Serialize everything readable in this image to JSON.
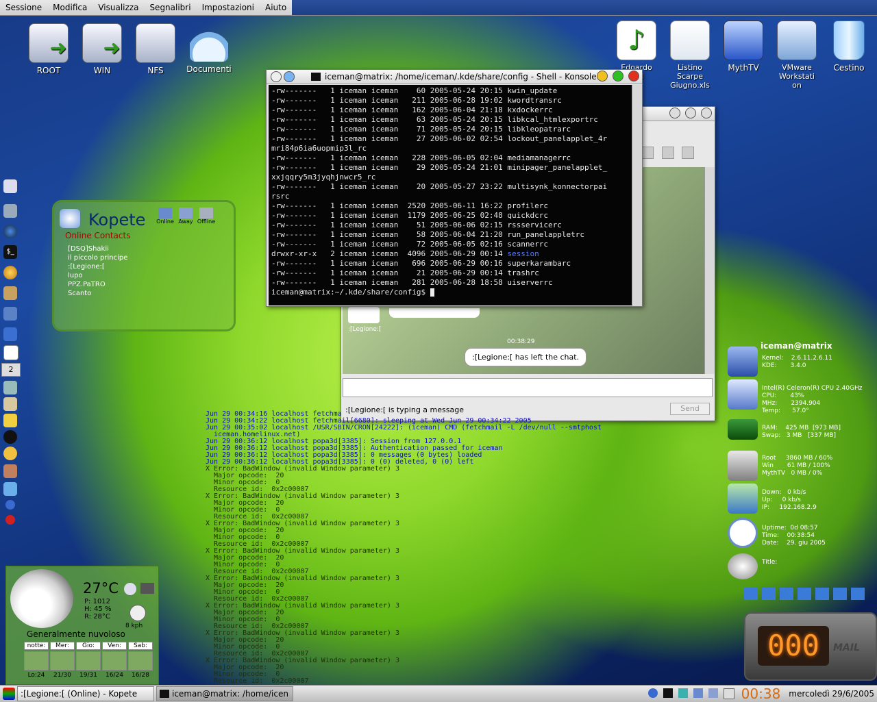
{
  "menubar": {
    "items": [
      "Sessione",
      "Modifica",
      "Visualizza",
      "Segnalibri",
      "Impostazioni",
      "Aiuto"
    ]
  },
  "desktop_icons_left": [
    "ROOT",
    "WIN",
    "NFS",
    "Documenti"
  ],
  "desktop_icons_right": [
    {
      "label": "Edoardo\n...-Il\nn...",
      "icon": "music-note-icon"
    },
    {
      "label": "Listino\nScarpe\nGiugno.xls",
      "icon": "spreadsheet-icon"
    },
    {
      "label": "MythTV",
      "icon": "monitor-icon"
    },
    {
      "label": "VMware\nWorkstati\non",
      "icon": "vmware-icon"
    },
    {
      "label": "Cestino",
      "icon": "trash-icon"
    }
  ],
  "konsole": {
    "title": "iceman@matrix: /home/iceman/.kde/share/config - Shell - Konsole",
    "lines": [
      "-rw-------   1 iceman iceman    60 2005-05-24 20:15 kwin_update",
      "-rw-------   1 iceman iceman   211 2005-06-28 19:02 kwordtransrc",
      "-rw-------   1 iceman iceman   162 2005-06-04 21:18 kxdockerrc",
      "-rw-------   1 iceman iceman    63 2005-05-24 20:15 libkcal_htmlexportrc",
      "-rw-------   1 iceman iceman    71 2005-05-24 20:15 libkleopatrarc",
      "-rw-------   1 iceman iceman    27 2005-06-02 02:54 lockout_panelapplet_4r",
      "mri84p6ia6uopmip3l_rc",
      "-rw-------   1 iceman iceman   228 2005-06-05 02:04 mediamanagerrc",
      "-rw-------   1 iceman iceman    29 2005-05-24 21:01 minipager_panelapplet_",
      "xxjqqry5m3jyqhjnwcr5_rc",
      "-rw-------   1 iceman iceman    20 2005-05-27 23:22 multisynk_konnectorpai",
      "rsrc",
      "-rw-------   1 iceman iceman  2520 2005-06-11 16:22 profilerc",
      "-rw-------   1 iceman iceman  1179 2005-06-25 02:48 quickdcrc",
      "-rw-------   1 iceman iceman    51 2005-06-06 02:15 rssservicerc",
      "-rw-------   1 iceman iceman    58 2005-06-04 21:20 run_panelappletrc",
      "-rw-------   1 iceman iceman    72 2005-06-05 02:16 scannerrc",
      "drwxr-xr-x   2 iceman iceman  4096 2005-06-29 00:14 session",
      "-rw-------   1 iceman iceman   696 2005-06-29 00:16 superkarambarc",
      "-rw-------   1 iceman iceman    21 2005-06-29 00:14 trashrc",
      "-rw-------   1 iceman iceman   281 2005-06-28 18:58 uiserverrc",
      "iceman@matrix:~/.kde/share/config$ "
    ]
  },
  "chat": {
    "sender": ":[Legione:[",
    "time": "00:38:29",
    "message": ":[Legione:[  has left the chat.",
    "typing": ":[Legione:[  is typing a message",
    "send": "Send"
  },
  "kopete": {
    "title": "Kopete",
    "subtitle": "Online Contacts",
    "status_buttons": [
      "Online",
      "Away",
      "Offline"
    ],
    "contacts": [
      "[DSQ]Shakii",
      "il piccolo principe",
      ":[Legione:[",
      "lupo",
      "PPZ.PaTRO",
      "Scanto"
    ]
  },
  "weather": {
    "temp": "27°C",
    "pressure": "P:  1012",
    "humidity": "H:  45 %",
    "real": "R:  28°C",
    "wind": "8 kph",
    "condition": "Generalmente nuvoloso",
    "days": [
      {
        "name": "notte:",
        "range": "Lo:24"
      },
      {
        "name": "Mer:",
        "range": "21/30"
      },
      {
        "name": "Gio:",
        "range": "19/31"
      },
      {
        "name": "Ven:",
        "range": "16/24"
      },
      {
        "name": "Sab:",
        "range": "16/28"
      }
    ]
  },
  "log": {
    "lines": [
      {
        "t": "Jun 29 00:34:16 localhost fetchma",
        "c": "#1010c0"
      },
      {
        "t": "Jun 29 00:34:22 localhost fetchmail[6680]: sleeping at Wed Jun 29 00:34:22 2005",
        "c": "#1010c0"
      },
      {
        "t": "Jun 29 00:35:02 localhost /USR/SBIN/CRON[24222]: (iceman) CMD (fetchmail -L /dev/null --smtphost",
        "c": "#1010c0"
      },
      {
        "t": "  iceman.homelinux.net)",
        "c": "#1010c0"
      },
      {
        "t": "Jun 29 00:36:12 localhost popa3d[3385]: Session from 127.0.0.1",
        "c": "#1010c0"
      },
      {
        "t": "Jun 29 00:36:12 localhost popa3d[3385]: Authentication passed for iceman",
        "c": "#1010c0"
      },
      {
        "t": "Jun 29 00:36:12 localhost popa3d[3385]: 0 messages (0 bytes) loaded",
        "c": "#1010c0"
      },
      {
        "t": "Jun 29 00:36:12 localhost popa3d[3385]: 0 (0) deleted, 0 (0) left",
        "c": "#1010c0"
      },
      {
        "t": "X Error: BadWindow (invalid Window parameter) 3",
        "c": "#20300a"
      },
      {
        "t": "  Major opcode:  20",
        "c": "#20300a"
      },
      {
        "t": "  Minor opcode:  0",
        "c": "#20300a"
      },
      {
        "t": "  Resource id:  0x2c00007",
        "c": "#20300a"
      },
      {
        "t": "X Error: BadWindow (invalid Window parameter) 3",
        "c": "#20300a"
      },
      {
        "t": "  Major opcode:  20",
        "c": "#20300a"
      },
      {
        "t": "  Minor opcode:  0",
        "c": "#20300a"
      },
      {
        "t": "  Resource id:  0x2c00007",
        "c": "#20300a"
      },
      {
        "t": "X Error: BadWindow (invalid Window parameter) 3",
        "c": "#20300a"
      },
      {
        "t": "  Major opcode:  20",
        "c": "#20300a"
      },
      {
        "t": "  Minor opcode:  0",
        "c": "#20300a"
      },
      {
        "t": "  Resource id:  0x2c00007",
        "c": "#20300a"
      },
      {
        "t": "X Error: BadWindow (invalid Window parameter) 3",
        "c": "#20300a"
      },
      {
        "t": "  Major opcode:  20",
        "c": "#20300a"
      },
      {
        "t": "  Minor opcode:  0",
        "c": "#20300a"
      },
      {
        "t": "  Resource id:  0x2c00007",
        "c": "#20300a"
      },
      {
        "t": "X Error: BadWindow (invalid Window parameter) 3",
        "c": "#20300a"
      },
      {
        "t": "  Major opcode:  20",
        "c": "#20300a"
      },
      {
        "t": "  Minor opcode:  0",
        "c": "#20300a"
      },
      {
        "t": "  Resource id:  0x2c00007",
        "c": "#20300a"
      },
      {
        "t": "X Error: BadWindow (invalid Window parameter) 3",
        "c": "#20300a"
      },
      {
        "t": "  Major opcode:  20",
        "c": "#20300a"
      },
      {
        "t": "  Minor opcode:  0",
        "c": "#20300a"
      },
      {
        "t": "  Resource id:  0x2c00007",
        "c": "#20300a"
      },
      {
        "t": "X Error: BadWindow (invalid Window parameter) 3",
        "c": "#20300a"
      },
      {
        "t": "  Major opcode:  20",
        "c": "#20300a"
      },
      {
        "t": "  Minor opcode:  0",
        "c": "#20300a"
      },
      {
        "t": "  Resource id:  0x2c00007",
        "c": "#20300a"
      },
      {
        "t": "X Error: BadWindow (invalid Window parameter) 3",
        "c": "#20300a"
      },
      {
        "t": "  Major opcode:  20",
        "c": "#20300a"
      },
      {
        "t": "  Minor opcode:  0",
        "c": "#20300a"
      },
      {
        "t": "  Resource id:  0x2c00007",
        "c": "#20300a"
      }
    ]
  },
  "sysmon": {
    "host": "iceman@matrix",
    "kernel": "Kernel:    2.6.11.2.6.11\nKDE:       3.4.0",
    "cpu": "Intel(R) Celeron(R) CPU 2.40GHz\nCPU:       43%\nMHz:       2394.904\nTemp:      57.0°",
    "ram": "RAM:    425 MB  [973 MB]\nSwap:   3 MB   [337 MB]",
    "disk": "Root     3860 MB / 60%\nWin       61 MB / 100%\nMythTV   0 MB / 0%",
    "net": "Down:   0 kb/s\nUp:     0 kb/s\nIP:     192.168.2.9",
    "time": "Uptime:  0d 08:57\nTime:    00:38:54\nDate:    29. giu 2005",
    "title": "Title:"
  },
  "mail": {
    "counter": "000",
    "label": "MAIL"
  },
  "taskbar": {
    "tasks": [
      ":[Legione:[  (Online) - Kopete",
      "iceman@matrix: /home/icen"
    ],
    "clock": "00:38",
    "date": "mercoledì  29/6/2005",
    "virtual_desktop": "2"
  }
}
